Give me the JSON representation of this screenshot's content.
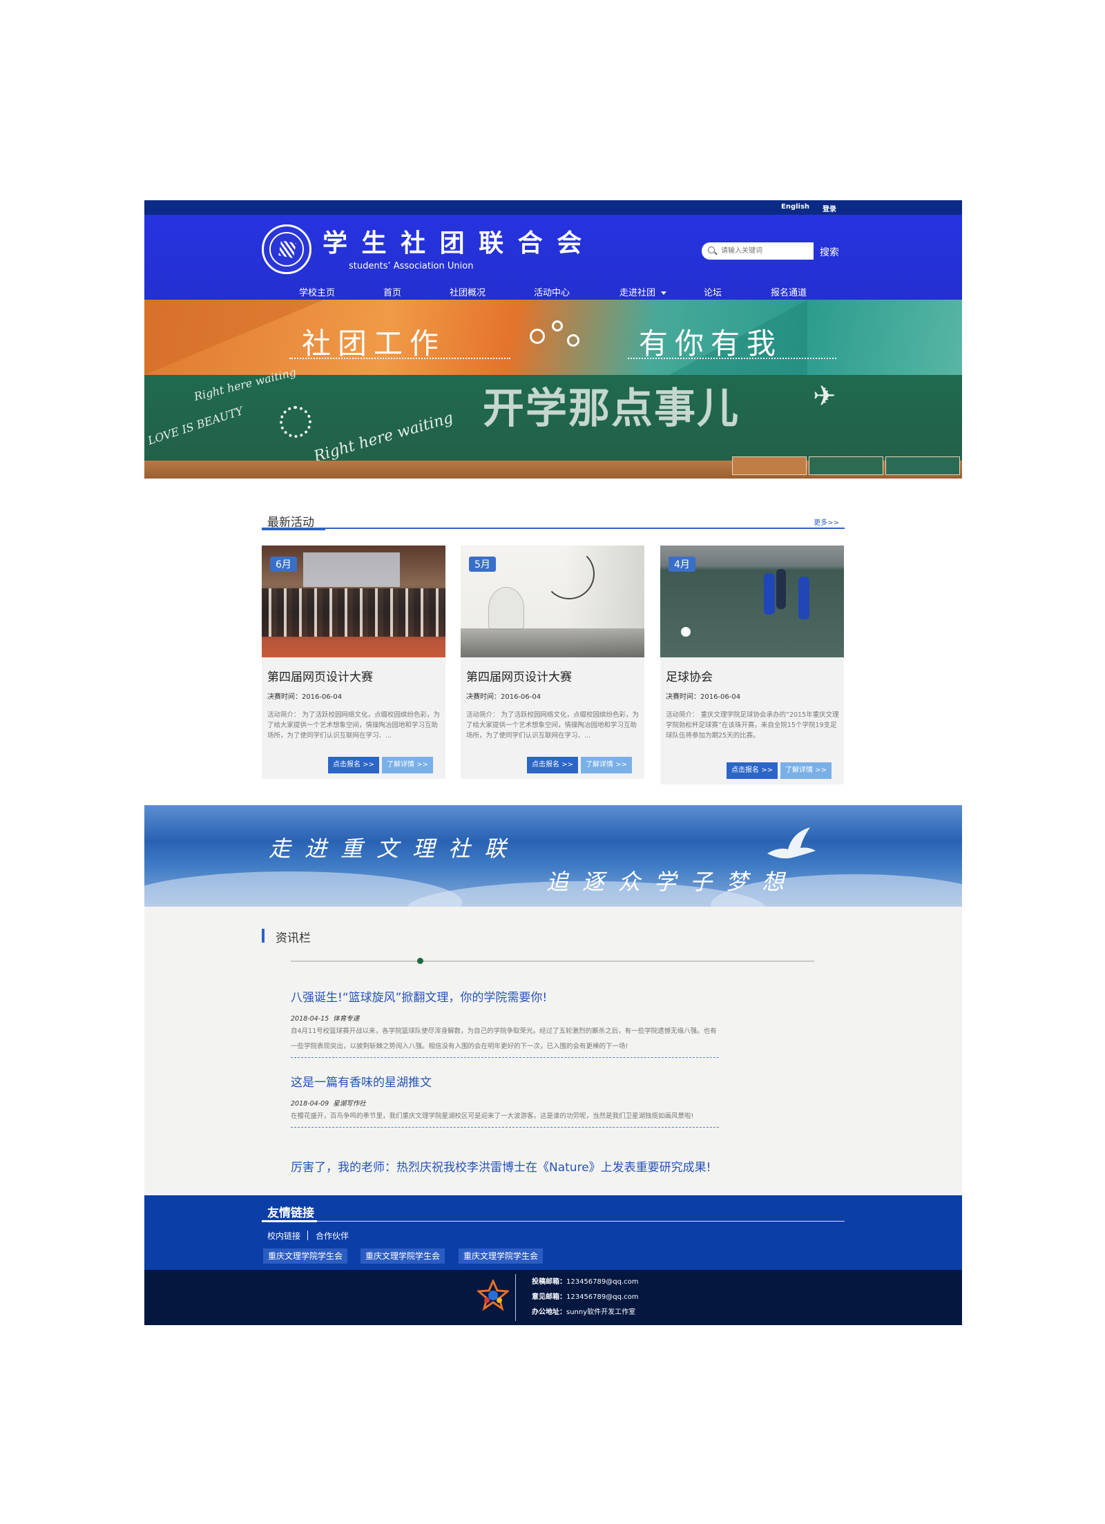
{
  "topbar": {
    "english": "English",
    "login": "登录"
  },
  "header": {
    "title": "学 生 社 团 联 合 会",
    "subtitle": "students’ Association Union",
    "search_placeholder": "请输入关键词",
    "search_button": "搜索"
  },
  "nav": [
    "学校主页",
    "首页",
    "社团概况",
    "活动中心",
    "走进社团",
    "论坛",
    "报名通道"
  ],
  "banner": {
    "headline_left": "社团工作",
    "headline_right": "有你有我",
    "chalk_text": "开学那点事儿",
    "doodle_1": "Right here waiting",
    "doodle_2": "LOVE IS BEAUTY",
    "doodle_3": "Right here waiting"
  },
  "latest": {
    "title": "最新活动",
    "more": "更多>>",
    "cards": [
      {
        "month": "6月",
        "title": "第四届网页设计大赛",
        "date": "决赛时间：2016-06-04",
        "desc": "活动简介： 为了活跃校园网络文化，点缀校园缤纷色彩，为了给大家提供一个艺术想象空间，情操陶冶园地和学习互助场所，为了使同学们认识互联网在学习、...",
        "btn_signup": "点击报名 >>",
        "btn_detail": "了解详情 >>"
      },
      {
        "month": "5月",
        "title": "第四届网页设计大赛",
        "date": "决赛时间：2016-06-04",
        "desc": "活动简介： 为了活跃校园网络文化，点缀校园缤纷色彩，为了给大家提供一个艺术想象空间，情操陶冶园地和学习互助场所，为了使同学们认识互联网在学习、...",
        "btn_signup": "点击报名 >>",
        "btn_detail": "了解详情 >>"
      },
      {
        "month": "4月",
        "title": "足球协会",
        "date": "决赛时间：2016-06-04",
        "desc": "活动简介： 重庆文理学院足球协会承办的“2015年重庆文理学院勃松杯足球赛”在该珠开赛，来自全院15个学院19支足球队伍将参加为期25天的比赛。",
        "btn_signup": "点击报名 >>",
        "btn_detail": "了解详情 >>"
      }
    ]
  },
  "sky": {
    "line1": "走进重文理社联",
    "line2": "追逐众学子梦想"
  },
  "news": {
    "title": "资讯栏",
    "items": [
      {
        "headline": "八强诞生!“篮球旋风”掀翻文理，你的学院需要你!",
        "date": "2018-04-15",
        "category": "体育专递",
        "body": "自4月11号校篮球赛开战以来，各学院篮球队使尽浑身解数，为自己的学院争取荣光。经过了五轮激烈的厮杀之后，有一些学院遗憾无缘八强。也有一些学院表现突出，以披荆斩棘之势闯入八强。相信没有入围的会在明年更好的下一次，已入围的会有更棒的下一场!"
      },
      {
        "headline": "这是一篇有香味的星湖推文",
        "date": "2018-04-09",
        "category": "星湖写作社",
        "body": "在樱花盛开，百鸟争鸣的季节里，我们重庆文理学院星湖校区可是迎来了一大波游客。这是谁的功劳呢，当然是我们卫星湖独揽如画风景啦!"
      },
      {
        "headline": "厉害了，我的老师：热烈庆祝我校李洪雷博士在《Nature》上发表重要研究成果!"
      }
    ]
  },
  "friends": {
    "title": "友情链接",
    "tabs": [
      "校内链接",
      "合作伙伴"
    ],
    "chips": [
      "重庆文理学院学生会",
      "重庆文理学院学生会",
      "重庆文理学院学生会"
    ]
  },
  "footer": {
    "submit_label": "投稿邮箱：",
    "submit_value": "123456789@qq.com",
    "feedback_label": "意见邮箱：",
    "feedback_value": "123456789@qq.com",
    "office_label": "办公地址：",
    "office_value": "sunny软件开发工作室"
  },
  "colors": {
    "header_blue": "#2633e0",
    "topbar_navy": "#0b2a86",
    "accent_blue": "#2d62c4",
    "friends_blue": "#0c3ea8",
    "footer_navy": "#04173f"
  },
  "icons": [
    "search-icon",
    "caret-down-icon",
    "site-logo",
    "dove-image",
    "footer-logo"
  ]
}
